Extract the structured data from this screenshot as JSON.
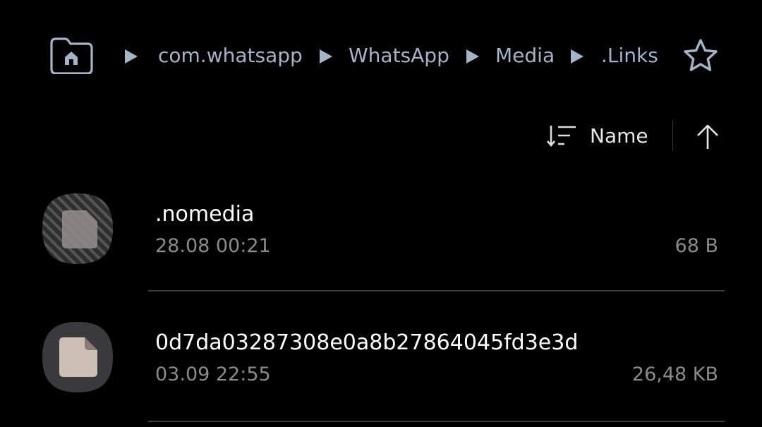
{
  "breadcrumb": {
    "items": [
      {
        "label": "com.whatsapp"
      },
      {
        "label": "WhatsApp"
      },
      {
        "label": "Media"
      },
      {
        "label": ".Links"
      }
    ],
    "home_icon": "folder-home-icon",
    "favorite_icon": "star-outline-icon"
  },
  "sort": {
    "label": "Name",
    "sort_icon": "sort-lines-icon",
    "direction_icon": "arrow-up-icon"
  },
  "files": [
    {
      "name": ".nomedia",
      "date": "28.08 00:21",
      "size": "68 B",
      "icon": "hidden-file-icon"
    },
    {
      "name": "0d7da03287308e0a8b27864045fd3e3d",
      "date": "03.09 22:55",
      "size": "26,48 KB",
      "icon": "file-icon"
    }
  ],
  "colors": {
    "background": "#000000",
    "breadcrumb_text": "#a6b3c6",
    "primary_text": "#ffffff",
    "secondary_text": "#8b8b8b",
    "divider": "#3d3d3d"
  }
}
